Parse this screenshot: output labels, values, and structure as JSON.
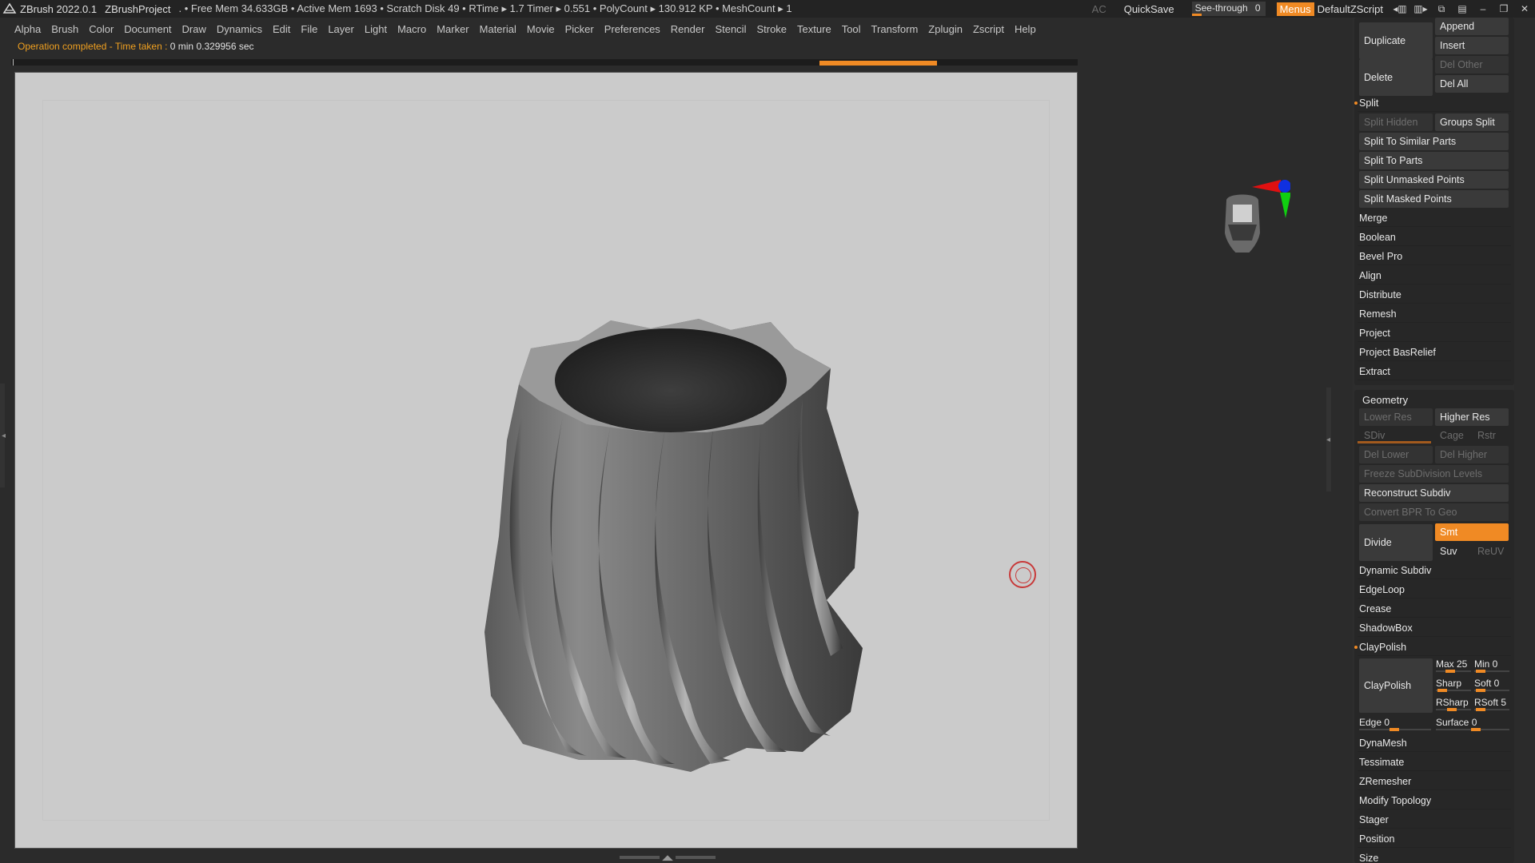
{
  "titlebar": {
    "app": "ZBrush 2022.0.1",
    "project": "ZBrushProject",
    "stats": ". • Free Mem 34.633GB • Active Mem 1693 • Scratch Disk 49 • RTime ▸ 1.7 Timer ▸ 0.551 • PolyCount ▸ 130.912 KP • MeshCount ▸ 1",
    "ac": "AC",
    "quicksave": "QuickSave",
    "seethrough": "See-through",
    "seethrough_value": "0",
    "menus": "Menus",
    "script": "DefaultZScript"
  },
  "menu": [
    "Alpha",
    "Brush",
    "Color",
    "Document",
    "Draw",
    "Dynamics",
    "Edit",
    "File",
    "Layer",
    "Light",
    "Macro",
    "Marker",
    "Material",
    "Movie",
    "Picker",
    "Preferences",
    "Render",
    "Stencil",
    "Stroke",
    "Texture",
    "Tool",
    "Transform",
    "Zplugin",
    "Zscript",
    "Help"
  ],
  "status": {
    "label": "Operation completed - Time taken : ",
    "value": "0 min 0.329956",
    "unit": " sec"
  },
  "colors": {
    "accent": "#f08a24",
    "viewport": "#cbcbcb",
    "panel": "#272727"
  },
  "subtool": {
    "duplicate": "Duplicate",
    "append": "Append",
    "insert": "Insert",
    "delete": "Delete",
    "del_other": "Del Other",
    "del_all": "Del All",
    "split": "Split",
    "split_hidden": "Split Hidden",
    "groups_split": "Groups Split",
    "split_similar": "Split To Similar Parts",
    "split_parts": "Split To Parts",
    "split_unmasked": "Split Unmasked Points",
    "split_masked": "Split Masked Points",
    "rows": [
      "Merge",
      "Boolean",
      "Bevel Pro",
      "Align",
      "Distribute",
      "Remesh",
      "Project",
      "Project BasRelief",
      "Extract"
    ]
  },
  "geometry": {
    "title": "Geometry",
    "lower_res": "Lower Res",
    "higher_res": "Higher Res",
    "sdiv": "SDiv",
    "cage": "Cage",
    "rstr": "Rstr",
    "del_lower": "Del Lower",
    "del_higher": "Del Higher",
    "freeze": "Freeze SubDivision Levels",
    "reconstruct": "Reconstruct Subdiv",
    "convert_bpr": "Convert BPR To Geo",
    "divide": "Divide",
    "smt": "Smt",
    "suv": "Suv",
    "reuv": "ReUV",
    "rows1": [
      "Dynamic Subdiv",
      "EdgeLoop",
      "Crease",
      "ShadowBox"
    ],
    "claypolish_hdr": "ClayPolish",
    "claypolish_btn": "ClayPolish",
    "max": "Max 25",
    "min": "Min 0",
    "sharp": "Sharp",
    "soft": "Soft 0",
    "rsharp": "RSharp",
    "rsoft": "RSoft 5",
    "edge": "Edge 0",
    "surface": "Surface 0",
    "rows2": [
      "DynaMesh",
      "Tessimate",
      "ZRemesher",
      "Modify Topology",
      "Stager",
      "Position",
      "Size"
    ]
  }
}
